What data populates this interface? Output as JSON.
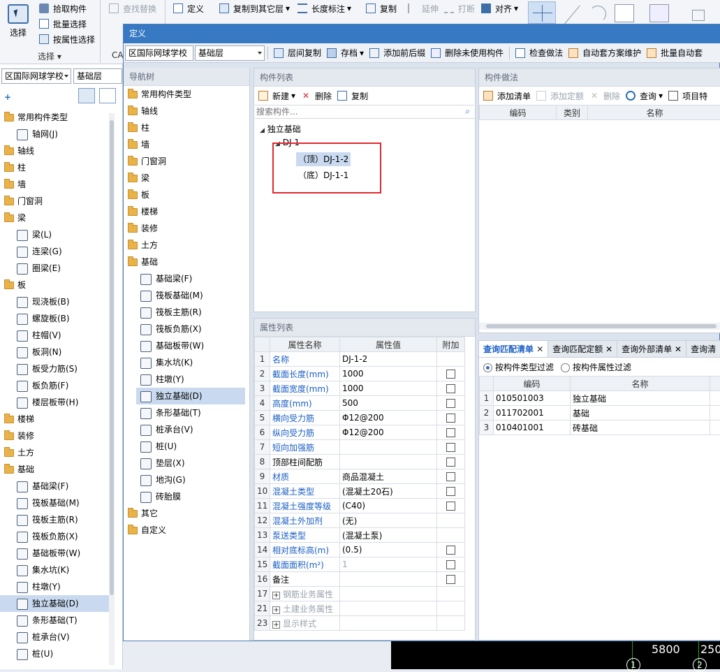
{
  "ribbon": {
    "select_label": "选择",
    "pick_label": "拾取构件",
    "batch_select_label": "批量选择",
    "attr_select_label": "按属性选择",
    "group_select_label": "选择",
    "find_replace_label": "查找替换",
    "define_label": "定义",
    "copy_to_layer_label": "复制到其它层",
    "length_label_label": "长度标注",
    "copy_label": "复制",
    "extend_label": "延伸",
    "break_label": "打断",
    "align_label": "对齐",
    "ca_label": "CA"
  },
  "left_panel": {
    "project": "区国际网球学校",
    "layer": "基础层",
    "items": [
      {
        "label": "常用构件类型",
        "type": "folder"
      },
      {
        "label": "轴网(J)",
        "type": "leaf"
      },
      {
        "label": "轴线",
        "type": "folder"
      },
      {
        "label": "柱",
        "type": "folder"
      },
      {
        "label": "墙",
        "type": "folder"
      },
      {
        "label": "门窗洞",
        "type": "folder"
      },
      {
        "label": "梁",
        "type": "folder"
      },
      {
        "label": "梁(L)",
        "type": "leaf"
      },
      {
        "label": "连梁(G)",
        "type": "leaf"
      },
      {
        "label": "圈梁(E)",
        "type": "leaf"
      },
      {
        "label": "板",
        "type": "folder"
      },
      {
        "label": "现浇板(B)",
        "type": "leaf"
      },
      {
        "label": "螺旋板(B)",
        "type": "leaf"
      },
      {
        "label": "柱帽(V)",
        "type": "leaf"
      },
      {
        "label": "板洞(N)",
        "type": "leaf"
      },
      {
        "label": "板受力筋(S)",
        "type": "leaf"
      },
      {
        "label": "板负筋(F)",
        "type": "leaf"
      },
      {
        "label": "楼层板带(H)",
        "type": "leaf"
      },
      {
        "label": "楼梯",
        "type": "folder"
      },
      {
        "label": "装修",
        "type": "folder"
      },
      {
        "label": "土方",
        "type": "folder"
      },
      {
        "label": "基础",
        "type": "folder"
      },
      {
        "label": "基础梁(F)",
        "type": "leaf"
      },
      {
        "label": "筏板基础(M)",
        "type": "leaf"
      },
      {
        "label": "筏板主筋(R)",
        "type": "leaf"
      },
      {
        "label": "筏板负筋(X)",
        "type": "leaf"
      },
      {
        "label": "基础板带(W)",
        "type": "leaf"
      },
      {
        "label": "集水坑(K)",
        "type": "leaf"
      },
      {
        "label": "柱墩(Y)",
        "type": "leaf"
      },
      {
        "label": "独立基础(D)",
        "type": "leaf",
        "selected": true
      },
      {
        "label": "条形基础(T)",
        "type": "leaf"
      },
      {
        "label": "桩承台(V)",
        "type": "leaf"
      },
      {
        "label": "桩(U)",
        "type": "leaf"
      }
    ]
  },
  "dialog": {
    "title": "定义",
    "project": "区国际网球学校",
    "layer": "基础层",
    "toolbar": [
      "层间复制",
      "存档",
      "添加前后缀",
      "删除未使用构件",
      "检查做法",
      "自动套方案维护",
      "批量自动套"
    ],
    "nav": {
      "title": "导航树",
      "items": [
        {
          "label": "常用构件类型",
          "type": "folder"
        },
        {
          "label": "轴线",
          "type": "folder"
        },
        {
          "label": "柱",
          "type": "folder"
        },
        {
          "label": "墙",
          "type": "folder"
        },
        {
          "label": "门窗洞",
          "type": "folder"
        },
        {
          "label": "梁",
          "type": "folder"
        },
        {
          "label": "板",
          "type": "folder"
        },
        {
          "label": "楼梯",
          "type": "folder"
        },
        {
          "label": "装修",
          "type": "folder"
        },
        {
          "label": "土方",
          "type": "folder"
        },
        {
          "label": "基础",
          "type": "folder"
        },
        {
          "label": "基础梁(F)",
          "type": "leaf"
        },
        {
          "label": "筏板基础(M)",
          "type": "leaf"
        },
        {
          "label": "筏板主筋(R)",
          "type": "leaf"
        },
        {
          "label": "筏板负筋(X)",
          "type": "leaf"
        },
        {
          "label": "基础板带(W)",
          "type": "leaf"
        },
        {
          "label": "集水坑(K)",
          "type": "leaf"
        },
        {
          "label": "柱墩(Y)",
          "type": "leaf"
        },
        {
          "label": "独立基础(D)",
          "type": "leaf",
          "selected": true
        },
        {
          "label": "条形基础(T)",
          "type": "leaf"
        },
        {
          "label": "桩承台(V)",
          "type": "leaf"
        },
        {
          "label": "桩(U)",
          "type": "leaf"
        },
        {
          "label": "垫层(X)",
          "type": "leaf"
        },
        {
          "label": "地沟(G)",
          "type": "leaf"
        },
        {
          "label": "砖胎膜",
          "type": "leaf"
        },
        {
          "label": "其它",
          "type": "folder"
        },
        {
          "label": "自定义",
          "type": "folder"
        }
      ]
    },
    "component_list": {
      "title": "构件列表",
      "new_label": "新建",
      "delete_label": "删除",
      "copy_label": "复制",
      "search_placeholder": "搜索构件...",
      "root": "独立基础",
      "group": "DJ-1",
      "children": [
        "（顶）DJ-1-2",
        "（底）DJ-1-1"
      ]
    },
    "method": {
      "title": "构件做法",
      "add_list": "添加清单",
      "add_quota": "添加定额",
      "delete": "删除",
      "query": "查询",
      "item_feature": "项目特",
      "columns": [
        "编码",
        "类别",
        "名称"
      ]
    },
    "properties": {
      "title": "属性列表",
      "columns": [
        "属性名称",
        "属性值",
        "附加"
      ],
      "rows": [
        {
          "n": "1",
          "name": "名称",
          "value": "DJ-1-2",
          "blue": true,
          "chk": false
        },
        {
          "n": "2",
          "name": "截面长度(mm)",
          "value": "1000",
          "blue": true,
          "chk": true
        },
        {
          "n": "3",
          "name": "截面宽度(mm)",
          "value": "1000",
          "blue": true,
          "chk": true
        },
        {
          "n": "4",
          "name": "高度(mm)",
          "value": "500",
          "blue": true,
          "chk": true
        },
        {
          "n": "5",
          "name": "横向受力筋",
          "value": "Φ12@200",
          "blue": true,
          "chk": true
        },
        {
          "n": "6",
          "name": "纵向受力筋",
          "value": "Φ12@200",
          "blue": true,
          "chk": true
        },
        {
          "n": "7",
          "name": "短向加强筋",
          "value": "",
          "blue": true,
          "chk": true
        },
        {
          "n": "8",
          "name": "顶部柱间配筋",
          "value": "",
          "blue": false,
          "chk": true
        },
        {
          "n": "9",
          "name": "材质",
          "value": "商品混凝土",
          "blue": true,
          "chk": true
        },
        {
          "n": "10",
          "name": "混凝土类型",
          "value": "(混凝土20石)",
          "blue": true,
          "chk": true
        },
        {
          "n": "11",
          "name": "混凝土强度等级",
          "value": "(C40)",
          "blue": true,
          "chk": true
        },
        {
          "n": "12",
          "name": "混凝土外加剂",
          "value": "(无)",
          "blue": true,
          "chk": false
        },
        {
          "n": "13",
          "name": "泵送类型",
          "value": "(混凝土泵)",
          "blue": true,
          "chk": false
        },
        {
          "n": "14",
          "name": "相对底标高(m)",
          "value": "(0.5)",
          "blue": true,
          "chk": true
        },
        {
          "n": "15",
          "name": "截面面积(m²)",
          "value": "1",
          "blue": true,
          "chk": true,
          "grayval": true
        },
        {
          "n": "16",
          "name": "备注",
          "value": "",
          "blue": false,
          "chk": true
        },
        {
          "n": "17",
          "name": "钢筋业务属性",
          "value": "",
          "expand": true
        },
        {
          "n": "21",
          "name": "土建业务属性",
          "value": "",
          "expand": true
        },
        {
          "n": "23",
          "name": "显示样式",
          "value": "",
          "expand": true
        }
      ]
    },
    "query": {
      "tabs": [
        "查询匹配清单",
        "查询匹配定额",
        "查询外部清单",
        "查询清"
      ],
      "filter_type": "按构件类型过滤",
      "filter_attr": "按构件属性过滤",
      "columns": [
        "编码",
        "名称"
      ],
      "rows": [
        {
          "n": "1",
          "code": "010501003",
          "name": "独立基础"
        },
        {
          "n": "2",
          "code": "011702001",
          "name": "基础"
        },
        {
          "n": "3",
          "code": "010401001",
          "name": "砖基础"
        }
      ]
    }
  },
  "canvas": {
    "dim1": "5800",
    "dim2": "250",
    "axis1": "1",
    "axis2": "2"
  },
  "colors": {
    "title_bar": "#3779c2",
    "selection": "#c9daf0",
    "highlight_box": "#e0282e",
    "link_blue": "#1b5fc4"
  }
}
